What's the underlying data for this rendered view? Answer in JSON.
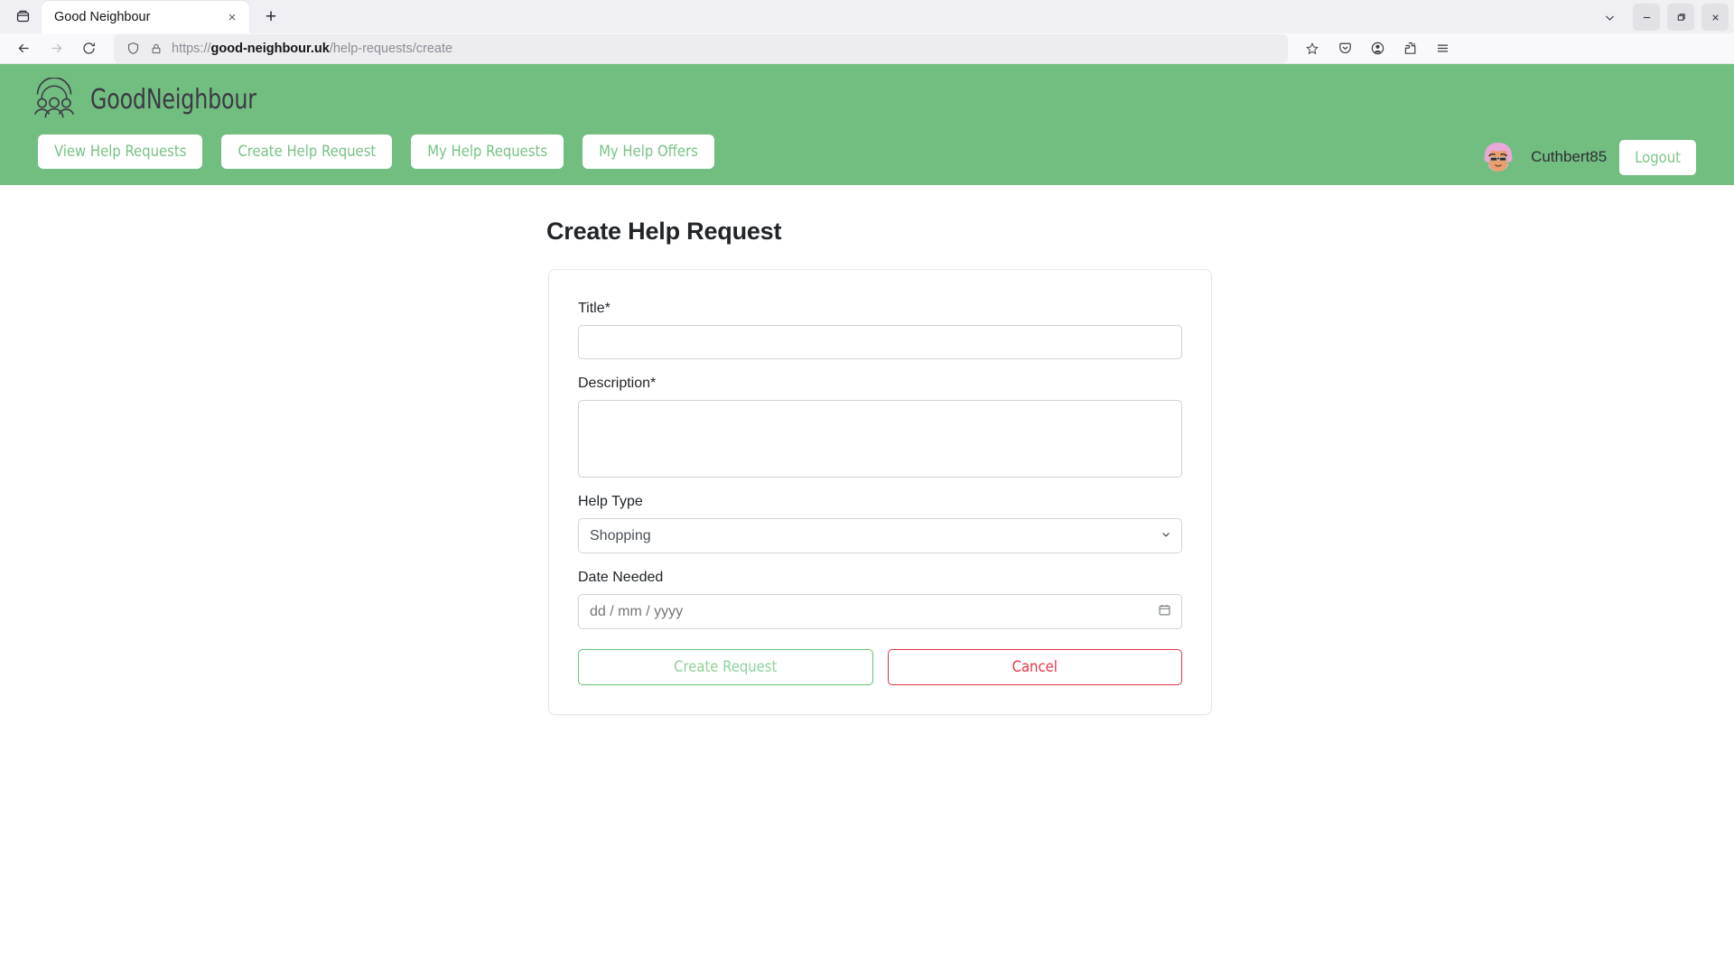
{
  "browser": {
    "tab_title": "Good Neighbour",
    "url_protocol": "https://",
    "url_domain": "good-neighbour.uk",
    "url_path": "/help-requests/create",
    "new_tab_label": "+",
    "close_tab_label": "×",
    "window_minimize": "–",
    "window_maximize": "❐",
    "window_close": "×"
  },
  "app": {
    "brand": "GoodNeighbour",
    "nav": [
      {
        "label": "View Help Requests"
      },
      {
        "label": "Create Help Request"
      },
      {
        "label": "My Help Requests"
      },
      {
        "label": "My Help Offers"
      }
    ],
    "user": {
      "name": "Cuthbert85",
      "logout_label": "Logout"
    },
    "colors": {
      "header_green": "#72bd80",
      "pill_text_green": "#77c286",
      "create_border": "#63c374",
      "cancel_red": "#dc3545"
    }
  },
  "main": {
    "page_title": "Create Help Request",
    "form": {
      "title": {
        "label": "Title*",
        "value": "",
        "placeholder": ""
      },
      "description": {
        "label": "Description*",
        "value": "",
        "placeholder": ""
      },
      "help_type": {
        "label": "Help Type",
        "selected": "Shopping",
        "options": [
          "Shopping"
        ]
      },
      "date_needed": {
        "label": "Date Needed",
        "value": "",
        "placeholder": "dd / mm / yyyy"
      },
      "submit_label": "Create Request",
      "cancel_label": "Cancel"
    }
  }
}
